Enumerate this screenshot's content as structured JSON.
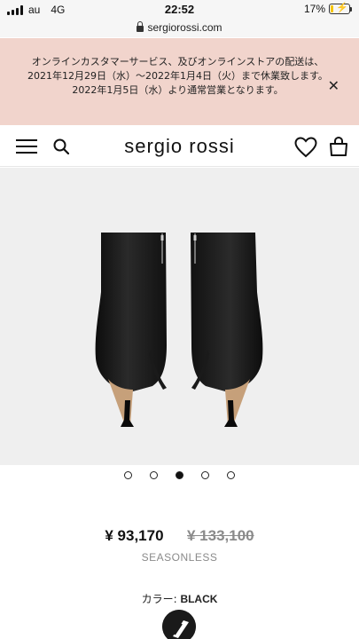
{
  "status_bar": {
    "carrier": "au",
    "network": "4G",
    "time": "22:52",
    "battery": "17%",
    "battery_level": 0.17
  },
  "browser": {
    "url": "sergiorossi.com"
  },
  "notice": {
    "text": "オンラインカスタマーサービス、及びオンラインストアの配送は、2021年12月29日（水）〜2022年1月4日（火）まで休業致します。2022年1月5日（水）より通常営業となります。",
    "close_icon": "close-icon"
  },
  "header": {
    "brand": "sergio rossi",
    "icons": [
      "menu-icon",
      "search-icon",
      "heart-icon",
      "bag-icon"
    ]
  },
  "carousel": {
    "total": 5,
    "active_index": 2
  },
  "product": {
    "price": "¥ 93,170",
    "original_price": "¥ 133,100",
    "season": "SEASONLESS",
    "color_label": "カラー:",
    "color_value": "BLACK"
  },
  "colors": {
    "notice_bg": "#f1d4cc",
    "image_bg": "#efefef",
    "swatch": "#1a1a1a"
  }
}
